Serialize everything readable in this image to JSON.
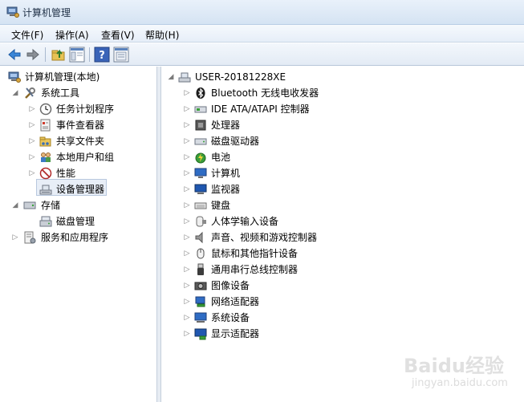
{
  "window": {
    "title": "计算机管理"
  },
  "menu": [
    "文件(F)",
    "操作(A)",
    "查看(V)",
    "帮助(H)"
  ],
  "toolbar": [
    "back-icon",
    "forward-icon",
    "up-folder-icon",
    "show-hide-tree-icon",
    "help-icon",
    "properties-icon"
  ],
  "left_tree": {
    "root": "计算机管理(本地)",
    "system_tools": "系统工具",
    "system_tools_children": [
      "任务计划程序",
      "事件查看器",
      "共享文件夹",
      "本地用户和组",
      "性能",
      "设备管理器"
    ],
    "storage": "存储",
    "disk_management": "磁盘管理",
    "services": "服务和应用程序",
    "selected": "设备管理器"
  },
  "device_tree": {
    "root": "USER-20181228XE",
    "categories": [
      "Bluetooth 无线电收发器",
      "IDE ATA/ATAPI 控制器",
      "处理器",
      "磁盘驱动器",
      "电池",
      "计算机",
      "监视器",
      "键盘",
      "人体学输入设备",
      "声音、视频和游戏控制器",
      "鼠标和其他指针设备",
      "通用串行总线控制器",
      "图像设备",
      "网络适配器",
      "系统设备",
      "显示适配器"
    ]
  },
  "watermark": {
    "brand": "Baidu经验",
    "url": "jingyan.baidu.com"
  }
}
